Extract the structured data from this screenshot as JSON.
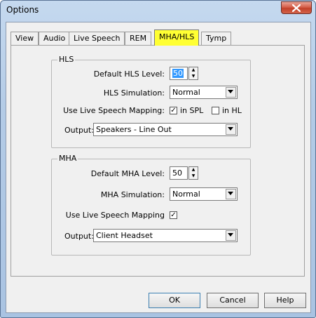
{
  "window": {
    "title": "Options"
  },
  "tabs": [
    "View",
    "Audio",
    "Live Speech",
    "REM",
    "MHA/HLS",
    "Tymp"
  ],
  "active_tab": "MHA/HLS",
  "hls": {
    "group_title": "HLS",
    "default_level_label": "Default HLS Level:",
    "default_level_value": "50",
    "simulation_label": "HLS Simulation:",
    "simulation_value": "Normal",
    "mapping_label": "Use Live Speech Mapping:",
    "in_spl_label": "in SPL",
    "in_spl_checked": true,
    "in_hl_label": "in HL",
    "in_hl_checked": false,
    "output_label": "Output:",
    "output_value": "Speakers - Line Out"
  },
  "mha": {
    "group_title": "MHA",
    "default_level_label": "Default MHA Level:",
    "default_level_value": "50",
    "simulation_label": "MHA Simulation:",
    "simulation_value": "Normal",
    "mapping_label": "Use Live Speech Mapping",
    "mapping_checked": true,
    "output_label": "Output:",
    "output_value": "Client Headset"
  },
  "buttons": {
    "ok": "OK",
    "cancel": "Cancel",
    "help": "Help"
  },
  "colors": {
    "active_tab": "#ffff33",
    "selection": "#3399ff",
    "close_button": "#c3412a"
  }
}
